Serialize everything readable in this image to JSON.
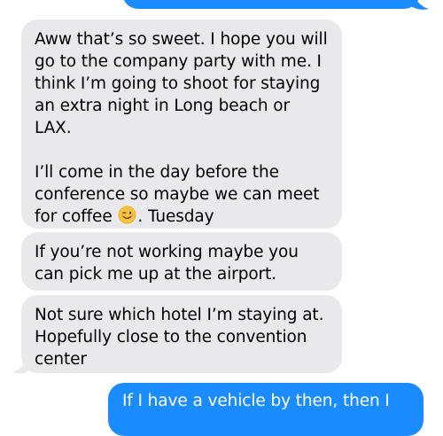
{
  "colors": {
    "incoming_bubble": "#e9e9eb",
    "outgoing_bubble": "#1a8cff",
    "incoming_text": "#000000",
    "outgoing_text": "#ffffff"
  },
  "messages": [
    {
      "direction": "incoming",
      "text_before_emoji": "Aww that’s so sweet. I hope you will go to the company party with me. I think I’m going to shoot for staying an extra night in Long beach or LAX.\n\nI’ll come in the day before the conference so maybe we can meet for coffee ",
      "emoji": "winking-face",
      "text_after_emoji": ". Tuesday"
    },
    {
      "direction": "incoming",
      "text": "If you’re not working maybe you can pick me up at the airport."
    },
    {
      "direction": "incoming",
      "text": "Not sure which hotel I’m staying at. Hopefully close to the convention center"
    },
    {
      "direction": "outgoing",
      "text": "If I have a vehicle by then, then I"
    }
  ]
}
